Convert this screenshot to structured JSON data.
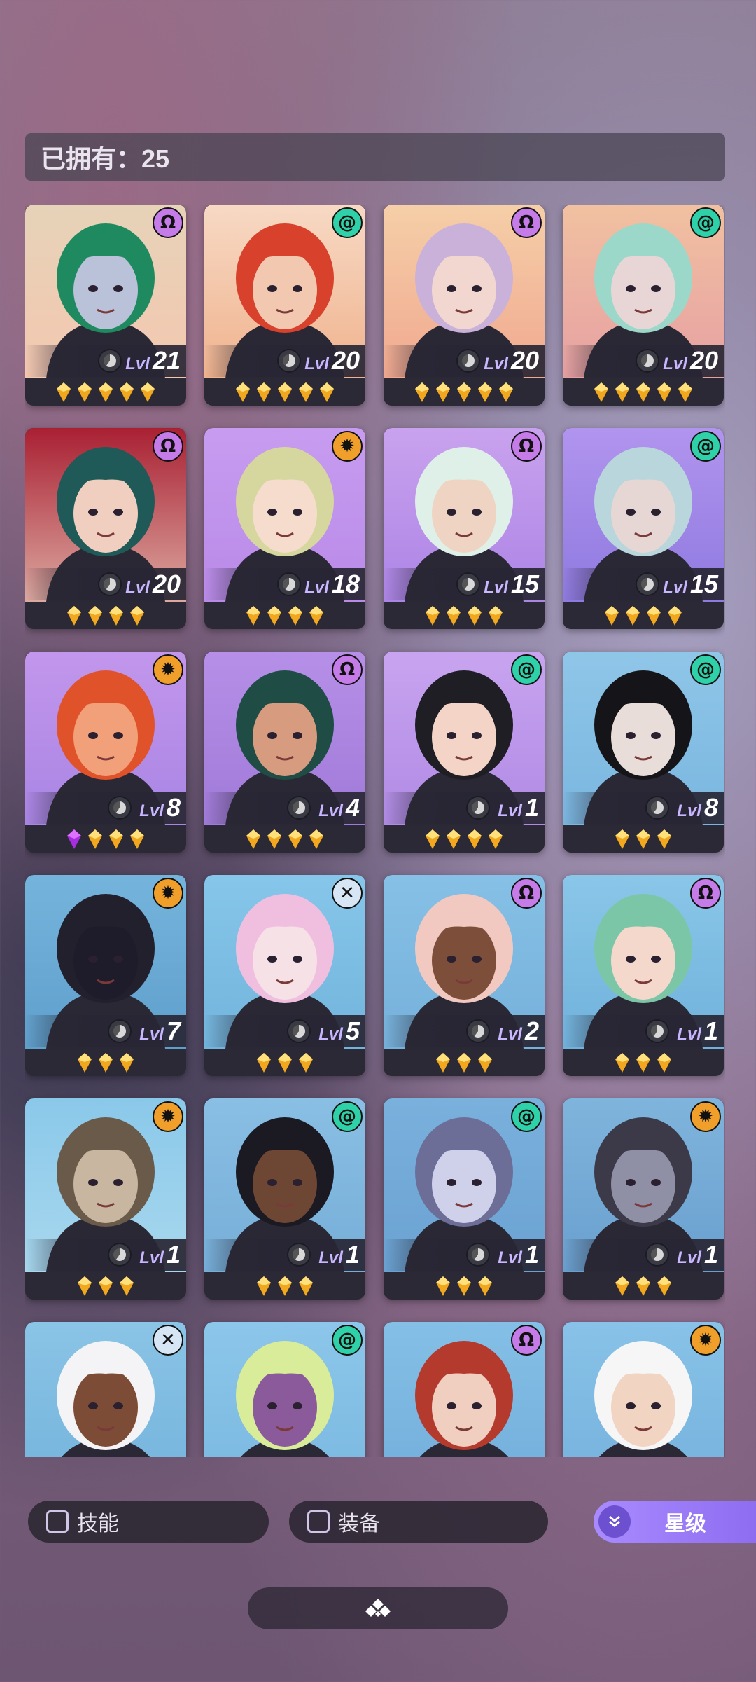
{
  "header": {
    "owned_text": "已拥有：25"
  },
  "roster": [
    {
      "level": "21",
      "stars": 5,
      "faction": "omega-icon",
      "bg": [
        "#e6d3b8",
        "#f4c7b0"
      ],
      "skin": "#b9c2d8",
      "hair": "#1f8a60"
    },
    {
      "level": "20",
      "stars": 5,
      "faction": "swirl-icon",
      "bg": [
        "#f7d9c4",
        "#f0b38e"
      ],
      "skin": "#f2c9b0",
      "hair": "#d8412b"
    },
    {
      "level": "20",
      "stars": 5,
      "faction": "omega-icon",
      "bg": [
        "#f5cfa8",
        "#f1a88f"
      ],
      "skin": "#f1d7cf",
      "hair": "#c9b1d9"
    },
    {
      "level": "20",
      "stars": 5,
      "faction": "swirl-icon",
      "bg": [
        "#f1c1a1",
        "#e7a0a2"
      ],
      "skin": "#e8d6d6",
      "hair": "#9bd8c9"
    },
    {
      "level": "20",
      "stars": 4,
      "faction": "omega-icon",
      "bg": [
        "#a92033",
        "#dca9a0"
      ],
      "skin": "#f0cfc0",
      "hair": "#1f5a58"
    },
    {
      "level": "18",
      "stars": 4,
      "faction": "gear-icon",
      "bg": [
        "#c79cf0",
        "#b98ae8"
      ],
      "skin": "#f6dccc",
      "hair": "#d5d79f"
    },
    {
      "level": "15",
      "stars": 4,
      "faction": "omega-icon",
      "bg": [
        "#c9a2ee",
        "#ac84e6"
      ],
      "skin": "#efd4c4",
      "hair": "#dff0e8"
    },
    {
      "level": "15",
      "stars": 4,
      "faction": "swirl-icon",
      "bg": [
        "#b194ee",
        "#8f7ae0"
      ],
      "skin": "#e7d7d4",
      "hair": "#b9d6dc"
    },
    {
      "level": "8",
      "stars": 4,
      "faction": "gear-icon",
      "bg": [
        "#c296ec",
        "#a985e4"
      ],
      "skin": "#f2a07a",
      "hair": "#e0522a",
      "firstGem": "purple"
    },
    {
      "level": "4",
      "stars": 4,
      "faction": "omega-icon",
      "bg": [
        "#b68fe8",
        "#a07ad8"
      ],
      "skin": "#d79b80",
      "hair": "#1f4d46"
    },
    {
      "level": "1",
      "stars": 4,
      "faction": "swirl-icon",
      "bg": [
        "#c8a4f0",
        "#b08ae4"
      ],
      "skin": "#f3d4c6",
      "hair": "#1e1e24"
    },
    {
      "level": "8",
      "stars": 3,
      "faction": "swirl-icon",
      "bg": [
        "#8fc6e8",
        "#7ab6e0"
      ],
      "skin": "#e9ddd9",
      "hair": "#151519"
    },
    {
      "level": "7",
      "stars": 3,
      "faction": "gear-icon",
      "bg": [
        "#74b4dc",
        "#5f9fcc"
      ],
      "skin": "#1e1c2a",
      "hair": "#23202e"
    },
    {
      "level": "5",
      "stars": 3,
      "faction": "cross-icon",
      "bg": [
        "#86c6ea",
        "#72b4dc"
      ],
      "skin": "#f6e1e6",
      "hair": "#f0bfe0"
    },
    {
      "level": "2",
      "stars": 3,
      "faction": "omega-icon",
      "bg": [
        "#86c0e6",
        "#76b1db"
      ],
      "skin": "#7d4e3a",
      "hair": "#f2c9c0"
    },
    {
      "level": "1",
      "stars": 3,
      "faction": "omega-icon",
      "bg": [
        "#8ac6e8",
        "#70b2dc"
      ],
      "skin": "#f4d8cc",
      "hair": "#7cc6a8"
    },
    {
      "level": "1",
      "stars": 3,
      "faction": "gear-icon",
      "bg": [
        "#8ac8ea",
        "#a8d8ee"
      ],
      "skin": "#c9b6a0",
      "hair": "#6a5a4a"
    },
    {
      "level": "1",
      "stars": 3,
      "faction": "swirl-icon",
      "bg": [
        "#8abfe4",
        "#76aed8"
      ],
      "skin": "#6e4634",
      "hair": "#1b1a22"
    },
    {
      "level": "1",
      "stars": 3,
      "faction": "swirl-icon",
      "bg": [
        "#7ab0dc",
        "#6aa2d2"
      ],
      "skin": "#cfd0ea",
      "hair": "#6d6e98"
    },
    {
      "level": "1",
      "stars": 3,
      "faction": "gear-icon",
      "bg": [
        "#7fb4dc",
        "#6aa0cf"
      ],
      "skin": "#8f8fa6",
      "hair": "#3c3a48"
    },
    {
      "level": "",
      "stars": 0,
      "faction": "cross-icon",
      "bg": [
        "#8ac4e6",
        "#74b3dc"
      ],
      "skin": "#7c4c36",
      "hair": "#f4f4f6"
    },
    {
      "level": "",
      "stars": 0,
      "faction": "swirl-icon",
      "bg": [
        "#8cc6ea",
        "#7ab8e0"
      ],
      "skin": "#8a5a9a",
      "hair": "#d8ec9a"
    },
    {
      "level": "",
      "stars": 0,
      "faction": "omega-icon",
      "bg": [
        "#84bfe6",
        "#72aedb"
      ],
      "skin": "#f0cfc0",
      "hair": "#b43a2e"
    },
    {
      "level": "",
      "stars": 0,
      "faction": "gear-icon",
      "bg": [
        "#88c2e8",
        "#74b1dc"
      ],
      "skin": "#f2d4c2",
      "hair": "#f6f6f6"
    }
  ],
  "level_prefix": "Lvl",
  "filters": {
    "skill_label": "技能",
    "equip_label": "装备",
    "sort_label": "星级"
  }
}
